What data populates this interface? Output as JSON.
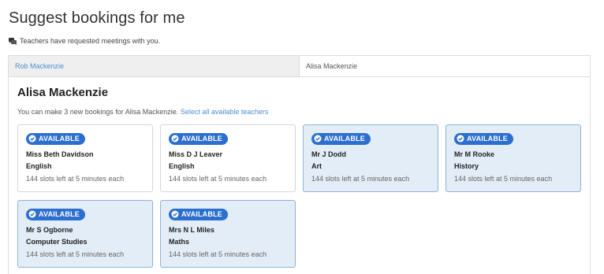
{
  "page": {
    "title": "Suggest bookings for me",
    "notice": "Teachers have requested meetings with you."
  },
  "tabs": [
    {
      "label": "Rob Mackenzie",
      "active": false
    },
    {
      "label": "Alisa Mackenzie",
      "active": true
    }
  ],
  "student": {
    "name": "Alisa Mackenzie",
    "info": "You can make 3 new bookings for Alisa Mackenzie.",
    "select_all_label": "Select all available teachers"
  },
  "colors": {
    "accent": "#2c6fd0",
    "link": "#4b8fd0",
    "selected_card_bg": "#e3edf7"
  },
  "cards": [
    {
      "status": "AVAILABLE",
      "teacher": "Miss Beth Davidson",
      "subject": "English",
      "slots": "144 slots left at 5 minutes each",
      "selected": false
    },
    {
      "status": "AVAILABLE",
      "teacher": "Miss D J Leaver",
      "subject": "English",
      "slots": "144 slots left at 5 minutes each",
      "selected": false
    },
    {
      "status": "AVAILABLE",
      "teacher": "Mr J Dodd",
      "subject": "Art",
      "slots": "144 slots left at 5 minutes each",
      "selected": true
    },
    {
      "status": "AVAILABLE",
      "teacher": "Mr M Rooke",
      "subject": "History",
      "slots": "144 slots left at 5 minutes each",
      "selected": true
    },
    {
      "status": "AVAILABLE",
      "teacher": "Mr S Ogborne",
      "subject": "Computer Studies",
      "slots": "144 slots left at 5 minutes each",
      "selected": true
    },
    {
      "status": "AVAILABLE",
      "teacher": "Mrs N L Miles",
      "subject": "Maths",
      "slots": "144 slots left at 5 minutes each",
      "selected": true
    }
  ]
}
